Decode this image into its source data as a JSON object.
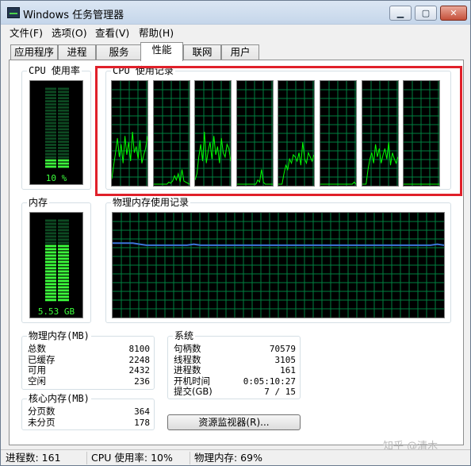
{
  "window": {
    "title": "Windows 任务管理器",
    "min_glyph": "▁",
    "max_glyph": "▢",
    "close_glyph": "✕"
  },
  "menu": [
    "文件(F)",
    "选项(O)",
    "查看(V)",
    "帮助(H)"
  ],
  "tabs": [
    "应用程序",
    "进程",
    "服务",
    "性能",
    "联网",
    "用户"
  ],
  "active_tab": "性能",
  "cpu_usage": {
    "title": "CPU 使用率",
    "value_label": "10 %",
    "level": 0.1
  },
  "cpu_history": {
    "title": "CPU 使用记录",
    "cores": [
      {
        "level": [
          5,
          18,
          30,
          44,
          26,
          38,
          20,
          46,
          28,
          40,
          22,
          50,
          30,
          36,
          24,
          42,
          20,
          28,
          34,
          46
        ]
      },
      {
        "level": [
          0,
          0,
          0,
          0,
          0,
          0,
          0,
          0,
          2,
          1,
          3,
          8,
          4,
          10,
          2,
          14,
          3,
          2,
          1,
          0
        ]
      },
      {
        "level": [
          4,
          10,
          26,
          38,
          22,
          50,
          20,
          32,
          40,
          24,
          46,
          28,
          36,
          20,
          44,
          30,
          26,
          38,
          34,
          22
        ]
      },
      {
        "level": [
          0,
          0,
          0,
          0,
          0,
          0,
          0,
          0,
          0,
          0,
          0,
          4,
          2,
          14,
          2,
          0,
          0,
          0,
          0,
          0
        ]
      },
      {
        "level": [
          0,
          0,
          0,
          10,
          18,
          14,
          24,
          20,
          28,
          26,
          22,
          30,
          18,
          40,
          24,
          20,
          30,
          26,
          22,
          28
        ]
      },
      {
        "level": [
          0,
          0,
          0,
          0,
          0,
          0,
          0,
          0,
          0,
          0,
          0,
          0,
          0,
          0,
          0,
          0,
          0,
          0,
          2,
          0
        ]
      },
      {
        "level": [
          0,
          0,
          0,
          14,
          24,
          30,
          20,
          38,
          26,
          34,
          20,
          28,
          34,
          24,
          40,
          18,
          30,
          24,
          20,
          26
        ]
      },
      {
        "level": [
          0,
          0,
          0,
          0,
          0,
          0,
          0,
          0,
          0,
          0,
          0,
          0,
          0,
          0,
          0,
          0,
          0,
          0,
          0,
          0
        ]
      }
    ]
  },
  "memory": {
    "title": "内存",
    "value_label": "5.53 GB",
    "level": 0.69
  },
  "memory_history": {
    "title": "物理内存使用记录",
    "level": [
      71,
      71,
      71,
      71,
      70,
      69,
      69,
      69,
      69,
      69,
      69,
      69,
      70,
      69,
      69,
      69,
      69,
      69,
      69,
      69,
      69,
      69,
      69,
      69,
      69,
      69,
      69,
      69,
      69,
      69,
      69,
      69,
      69,
      69,
      69,
      69,
      69,
      69,
      69,
      69,
      69,
      69,
      69,
      69,
      69,
      69,
      69,
      69,
      70,
      69
    ]
  },
  "physical_memory": {
    "title": "物理内存(MB)",
    "rows": [
      {
        "label": "总数",
        "value": "8100"
      },
      {
        "label": "已缓存",
        "value": "2248"
      },
      {
        "label": "可用",
        "value": "2432"
      },
      {
        "label": "空闲",
        "value": "236"
      }
    ]
  },
  "kernel_memory": {
    "title": "核心内存(MB)",
    "rows": [
      {
        "label": "分页数",
        "value": "364"
      },
      {
        "label": "未分页",
        "value": "178"
      }
    ]
  },
  "system": {
    "title": "系统",
    "rows": [
      {
        "label": "句柄数",
        "value": "70579"
      },
      {
        "label": "线程数",
        "value": "3105"
      },
      {
        "label": "进程数",
        "value": "161"
      },
      {
        "label": "开机时间",
        "value": "0:05:10:27"
      },
      {
        "label": "提交(GB)",
        "value": "7 / 15"
      }
    ]
  },
  "resource_monitor_button": "资源监视器(R)...",
  "status": {
    "processes": "进程数: 161",
    "cpu": "CPU 使用率: 10%",
    "memory": "物理内存: 69%"
  },
  "watermark": "知乎 @清木",
  "colors": {
    "graph_green": "#00ff00",
    "grid_green": "#008040",
    "memory_line": "#3b74d9",
    "highlight": "#e0202a"
  }
}
